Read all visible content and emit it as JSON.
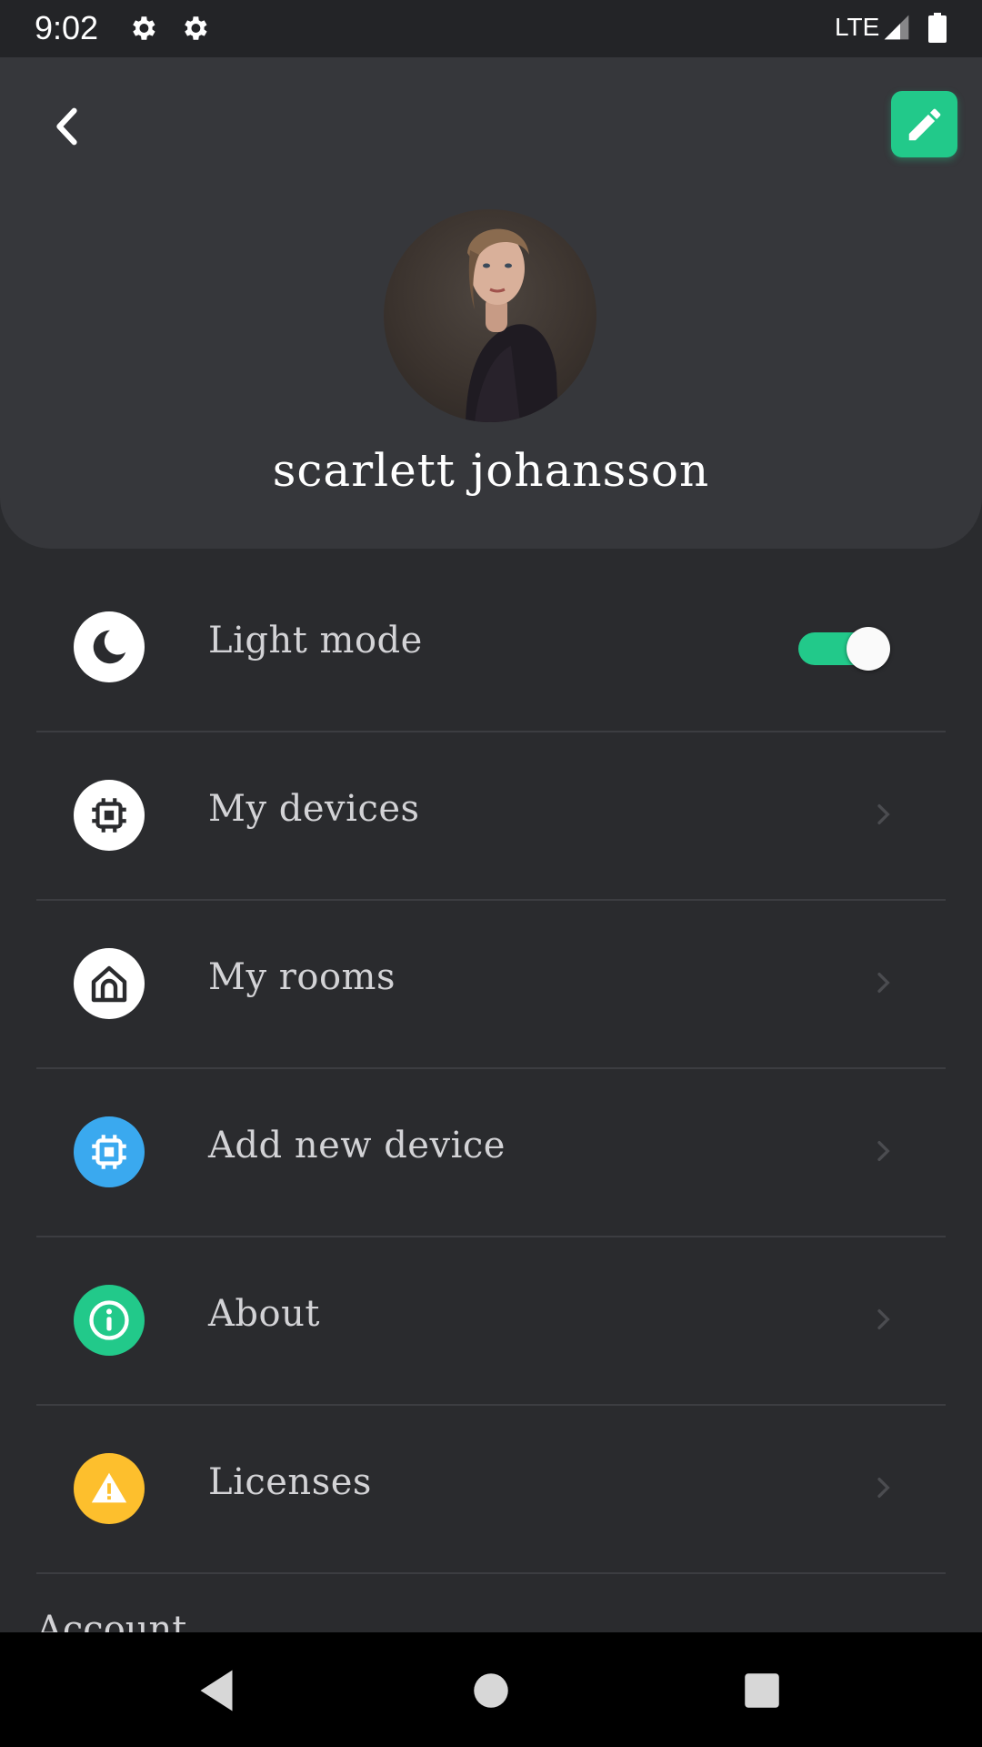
{
  "status_bar": {
    "time": "9:02",
    "network": "LTE",
    "icons": [
      "gear-icon",
      "gear-icon",
      "signal-icon",
      "battery-icon"
    ]
  },
  "header": {
    "back_icon": "chevron-left-icon",
    "edit_icon": "pencil-icon",
    "name": "scarlett johansson"
  },
  "colors": {
    "accent": "#22c98a",
    "background": "#2a2b2e",
    "header_bg": "#36373b",
    "blue": "#3aa9ef",
    "yellow": "#fdbf2d"
  },
  "menu": {
    "items": [
      {
        "label": "Light mode",
        "icon": "moon-icon",
        "control": "toggle",
        "toggle_on": true
      },
      {
        "label": "My devices",
        "icon": "chip-icon",
        "control": "chevron"
      },
      {
        "label": "My rooms",
        "icon": "home-icon",
        "control": "chevron"
      },
      {
        "label": "Add new device",
        "icon": "chip-icon",
        "control": "chevron"
      },
      {
        "label": "About",
        "icon": "info-icon",
        "control": "chevron"
      },
      {
        "label": "Licenses",
        "icon": "warning-icon",
        "control": "chevron"
      }
    ]
  },
  "section": {
    "account": "Account"
  },
  "nav_bar": {
    "buttons": [
      "back-nav-icon",
      "home-nav-icon",
      "recents-nav-icon"
    ]
  }
}
